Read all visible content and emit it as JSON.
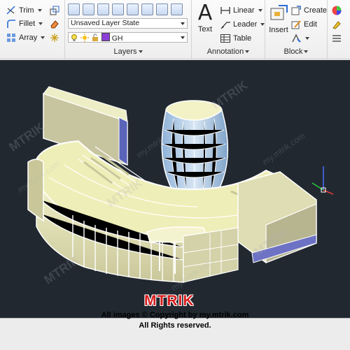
{
  "ribbon": {
    "modify": {
      "trim": "Trim",
      "fillet": "Fillet",
      "array": "Array"
    },
    "layers": {
      "title": "Layers",
      "layer_state": "Unsaved Layer State",
      "current_layer": "GH"
    },
    "annotation": {
      "title": "Annotation",
      "text": "Text",
      "linear": "Linear",
      "leader": "Leader",
      "table": "Table"
    },
    "block": {
      "title": "Block",
      "insert": "Insert",
      "create": "Create",
      "edit": "Edit"
    }
  },
  "watermark": {
    "logo": "MTRIK",
    "site": "my.mtrik.com",
    "copyright_line1": "All images © Copyright by my.mtrik.com",
    "copyright_line2": "All Rights reserved."
  },
  "colors": {
    "viewport_bg": "#212830",
    "model_face": "#eeeeb8",
    "glass": "#a9c7e6",
    "logo_red": "#d81f1f",
    "layer_swatch": "#8b3fd6"
  },
  "icons": [
    "trim-icon",
    "fillet-icon",
    "array-icon",
    "lightbulb-icon",
    "sun-icon",
    "lock-icon",
    "text-icon",
    "linear-icon",
    "leader-icon",
    "table-icon",
    "insert-icon",
    "create-icon",
    "edit-icon",
    "ucs-icon"
  ]
}
